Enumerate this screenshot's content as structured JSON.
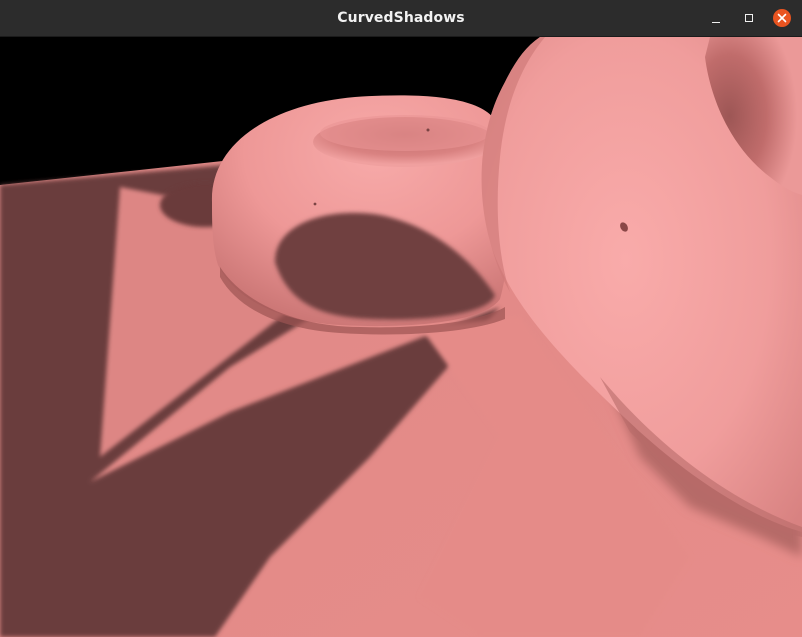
{
  "window": {
    "title": "CurvedShadows"
  },
  "titlebar_buttons": {
    "minimize_icon": "minimize-icon",
    "maximize_icon": "maximize-icon",
    "close_icon": "close-icon"
  },
  "scene": {
    "background_color": "#000000",
    "floor_color": "#e48a87",
    "floor_shadow_color": "#6b3c3c",
    "torus_color": "#f4a4a3",
    "torus_shade_color": "#8a4d4c",
    "torus_count": 2
  }
}
